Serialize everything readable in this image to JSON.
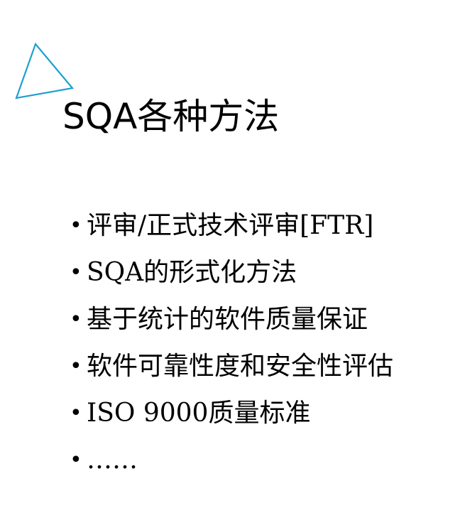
{
  "slide": {
    "title": "SQA各种方法",
    "accent_color": "#1e9fd0",
    "decor_icon": "triangle-outline-icon",
    "bullets": [
      {
        "marker": "•",
        "text": "评审/正式技术评审[FTR]"
      },
      {
        "marker": "•",
        "text": "SQA的形式化方法"
      },
      {
        "marker": "•",
        "text": "基于统计的软件质量保证"
      },
      {
        "marker": "•",
        "text": "软件可靠性度和安全性评估"
      },
      {
        "marker": "•",
        "text": "ISO 9000质量标准"
      },
      {
        "marker": "•",
        "text": "……"
      }
    ]
  }
}
